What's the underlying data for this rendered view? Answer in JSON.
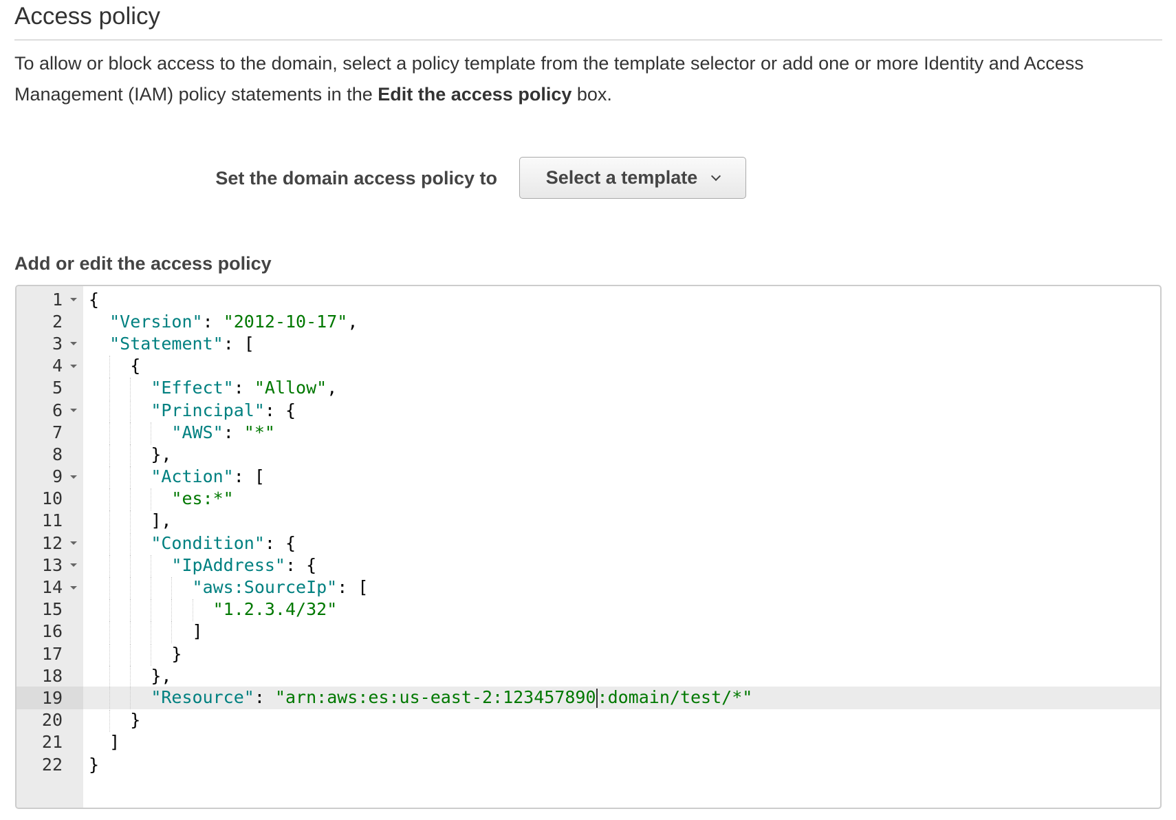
{
  "section": {
    "title": "Access policy",
    "description_pre": "To allow or block access to the domain, select a policy template from the template selector or add one or more Identity and Access Management (IAM) policy statements in the ",
    "description_bold": "Edit the access policy",
    "description_post": " box."
  },
  "template_row": {
    "label": "Set the domain access policy to",
    "select_value": "Select a template",
    "caret_icon": "chevron-down-icon"
  },
  "editor": {
    "label": "Add or edit the access policy",
    "active_line": 19,
    "colors": {
      "key": "#008080",
      "string": "#007800",
      "gutter": "#ebebeb",
      "active_line": "#ebebeb"
    },
    "lines": [
      {
        "n": "1",
        "fold": true,
        "indent": 0,
        "tokens": [
          [
            "p",
            "{"
          ]
        ]
      },
      {
        "n": "2",
        "fold": false,
        "indent": 1,
        "tokens": [
          [
            "k",
            "\"Version\""
          ],
          [
            "p",
            ": "
          ],
          [
            "s",
            "\"2012-10-17\""
          ],
          [
            "p",
            ","
          ]
        ]
      },
      {
        "n": "3",
        "fold": true,
        "indent": 1,
        "tokens": [
          [
            "k",
            "\"Statement\""
          ],
          [
            "p",
            ": ["
          ]
        ]
      },
      {
        "n": "4",
        "fold": true,
        "indent": 2,
        "tokens": [
          [
            "p",
            "{"
          ]
        ]
      },
      {
        "n": "5",
        "fold": false,
        "indent": 3,
        "tokens": [
          [
            "k",
            "\"Effect\""
          ],
          [
            "p",
            ": "
          ],
          [
            "s",
            "\"Allow\""
          ],
          [
            "p",
            ","
          ]
        ]
      },
      {
        "n": "6",
        "fold": true,
        "indent": 3,
        "tokens": [
          [
            "k",
            "\"Principal\""
          ],
          [
            "p",
            ": {"
          ]
        ]
      },
      {
        "n": "7",
        "fold": false,
        "indent": 4,
        "tokens": [
          [
            "k",
            "\"AWS\""
          ],
          [
            "p",
            ": "
          ],
          [
            "s",
            "\"*\""
          ]
        ]
      },
      {
        "n": "8",
        "fold": false,
        "indent": 3,
        "tokens": [
          [
            "p",
            "},"
          ]
        ]
      },
      {
        "n": "9",
        "fold": true,
        "indent": 3,
        "tokens": [
          [
            "k",
            "\"Action\""
          ],
          [
            "p",
            ": ["
          ]
        ]
      },
      {
        "n": "10",
        "fold": false,
        "indent": 4,
        "tokens": [
          [
            "s",
            "\"es:*\""
          ]
        ]
      },
      {
        "n": "11",
        "fold": false,
        "indent": 3,
        "tokens": [
          [
            "p",
            "],"
          ]
        ]
      },
      {
        "n": "12",
        "fold": true,
        "indent": 3,
        "tokens": [
          [
            "k",
            "\"Condition\""
          ],
          [
            "p",
            ": {"
          ]
        ]
      },
      {
        "n": "13",
        "fold": true,
        "indent": 4,
        "tokens": [
          [
            "k",
            "\"IpAddress\""
          ],
          [
            "p",
            ": {"
          ]
        ]
      },
      {
        "n": "14",
        "fold": true,
        "indent": 5,
        "tokens": [
          [
            "k",
            "\"aws:SourceIp\""
          ],
          [
            "p",
            ": ["
          ]
        ]
      },
      {
        "n": "15",
        "fold": false,
        "indent": 6,
        "tokens": [
          [
            "s",
            "\"1.2.3.4/32\""
          ]
        ]
      },
      {
        "n": "16",
        "fold": false,
        "indent": 5,
        "tokens": [
          [
            "p",
            "]"
          ]
        ]
      },
      {
        "n": "17",
        "fold": false,
        "indent": 4,
        "tokens": [
          [
            "p",
            "}"
          ]
        ]
      },
      {
        "n": "18",
        "fold": false,
        "indent": 3,
        "tokens": [
          [
            "p",
            "},"
          ]
        ]
      },
      {
        "n": "19",
        "fold": false,
        "indent": 3,
        "tokens": [
          [
            "k",
            "\"Resource\""
          ],
          [
            "p",
            ": "
          ],
          [
            "s",
            "\"arn:aws:es:us-east-2:123457890"
          ],
          [
            "c",
            ""
          ],
          [
            "s",
            ":domain/test/*\""
          ]
        ]
      },
      {
        "n": "20",
        "fold": false,
        "indent": 2,
        "tokens": [
          [
            "p",
            "}"
          ]
        ]
      },
      {
        "n": "21",
        "fold": false,
        "indent": 1,
        "tokens": [
          [
            "p",
            "]"
          ]
        ]
      },
      {
        "n": "22",
        "fold": false,
        "indent": 0,
        "tokens": [
          [
            "p",
            "}"
          ]
        ]
      }
    ]
  }
}
